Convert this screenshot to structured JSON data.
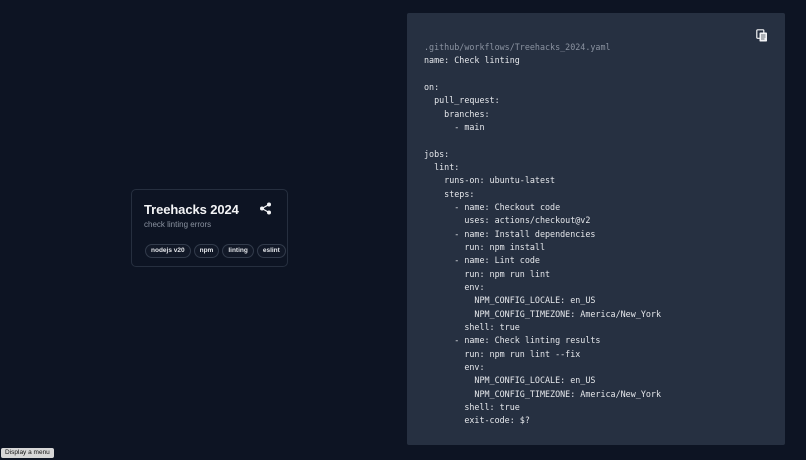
{
  "card": {
    "title": "Treehacks 2024",
    "subtitle": "check linting errors",
    "share_icon": "share-icon",
    "tags": [
      "nodejs v20",
      "npm",
      "linting",
      "eslint"
    ]
  },
  "code_panel": {
    "copy_icon": "copy-icon",
    "file_path": ".github/workflows/Treehacks_2024.yaml",
    "lines": [
      "name: Check linting",
      "",
      "on:",
      "  pull_request:",
      "    branches:",
      "      - main",
      "",
      "jobs:",
      "  lint:",
      "    runs-on: ubuntu-latest",
      "    steps:",
      "      - name: Checkout code",
      "        uses: actions/checkout@v2",
      "      - name: Install dependencies",
      "        run: npm install",
      "      - name: Lint code",
      "        run: npm run lint",
      "        env:",
      "          NPM_CONFIG_LOCALE: en_US",
      "          NPM_CONFIG_TIMEZONE: America/New_York",
      "        shell: true",
      "      - name: Check linting results",
      "        run: npm run lint --fix",
      "        env:",
      "          NPM_CONFIG_LOCALE: en_US",
      "          NPM_CONFIG_TIMEZONE: America/New_York",
      "        shell: true",
      "        exit-code: $?"
    ]
  },
  "tooltip": {
    "text": "Display a menu"
  },
  "colors": {
    "background": "#0d1423",
    "panel": "#263041",
    "text": "#e5e7eb",
    "muted": "#8b93a1"
  }
}
